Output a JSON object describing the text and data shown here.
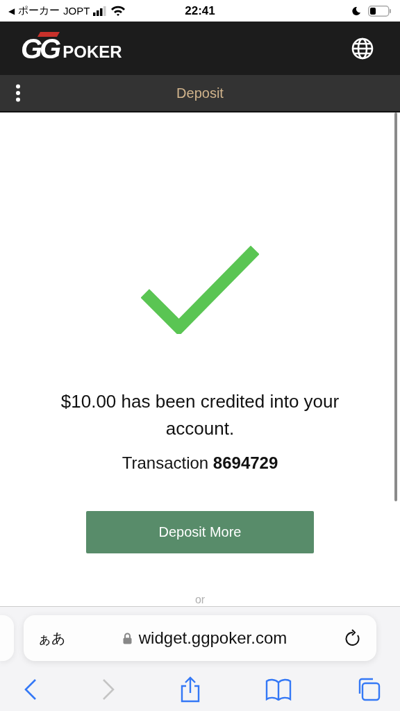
{
  "status_bar": {
    "back_glyph": "◀",
    "back_app": "ポーカー",
    "carrier": "JOPT",
    "time": "22:41"
  },
  "header": {
    "logo_gg": "GG",
    "logo_word": "POKER"
  },
  "subheader": {
    "title": "Deposit"
  },
  "result": {
    "message": "$10.00 has been credited into your account.",
    "transaction": "Transaction **8694729**",
    "button": "Deposit More",
    "separator": "or"
  },
  "browser": {
    "text_size": "ぁあ",
    "url": "widget.ggpoker.com",
    "toolbar": [
      {
        "kind": "back",
        "disabled": false
      },
      {
        "kind": "forward",
        "disabled": true
      },
      {
        "kind": "share",
        "disabled": false
      },
      {
        "kind": "bookmarks",
        "disabled": false
      },
      {
        "kind": "tabs",
        "disabled": false
      }
    ]
  }
}
